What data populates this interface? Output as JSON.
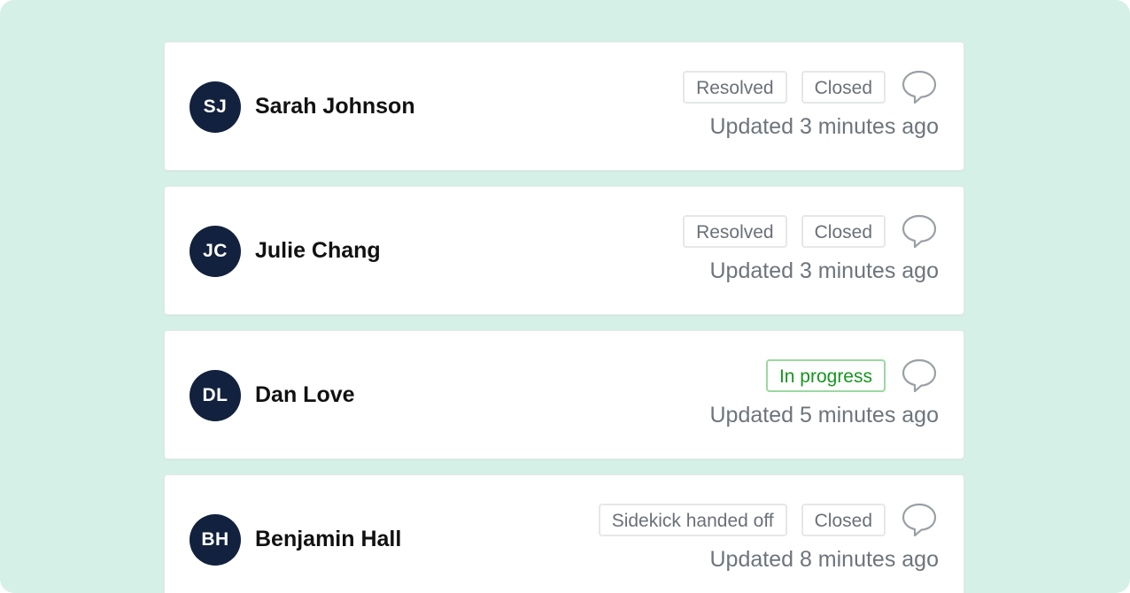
{
  "colors": {
    "background": "#d5f0e6",
    "avatar": "#12213e",
    "badge_neutral_text": "#6b7078",
    "badge_green_text": "#15961f",
    "badge_green_border": "#9bd7a2"
  },
  "tickets": [
    {
      "initials": "SJ",
      "name": "Sarah Johnson",
      "badges": [
        {
          "label": "Resolved",
          "variant": "neutral"
        },
        {
          "label": "Closed",
          "variant": "neutral"
        }
      ],
      "icon": "comment-icon",
      "updated": "Updated 3 minutes ago"
    },
    {
      "initials": "JC",
      "name": "Julie Chang",
      "badges": [
        {
          "label": "Resolved",
          "variant": "neutral"
        },
        {
          "label": "Closed",
          "variant": "neutral"
        }
      ],
      "icon": "comment-icon",
      "updated": "Updated 3 minutes ago"
    },
    {
      "initials": "DL",
      "name": "Dan Love",
      "badges": [
        {
          "label": "In progress",
          "variant": "green"
        }
      ],
      "icon": "comment-icon",
      "updated": "Updated 5 minutes ago"
    },
    {
      "initials": "BH",
      "name": "Benjamin Hall",
      "badges": [
        {
          "label": "Sidekick handed off",
          "variant": "neutral"
        },
        {
          "label": "Closed",
          "variant": "neutral"
        }
      ],
      "icon": "comment-icon",
      "updated": "Updated 8 minutes ago"
    }
  ]
}
